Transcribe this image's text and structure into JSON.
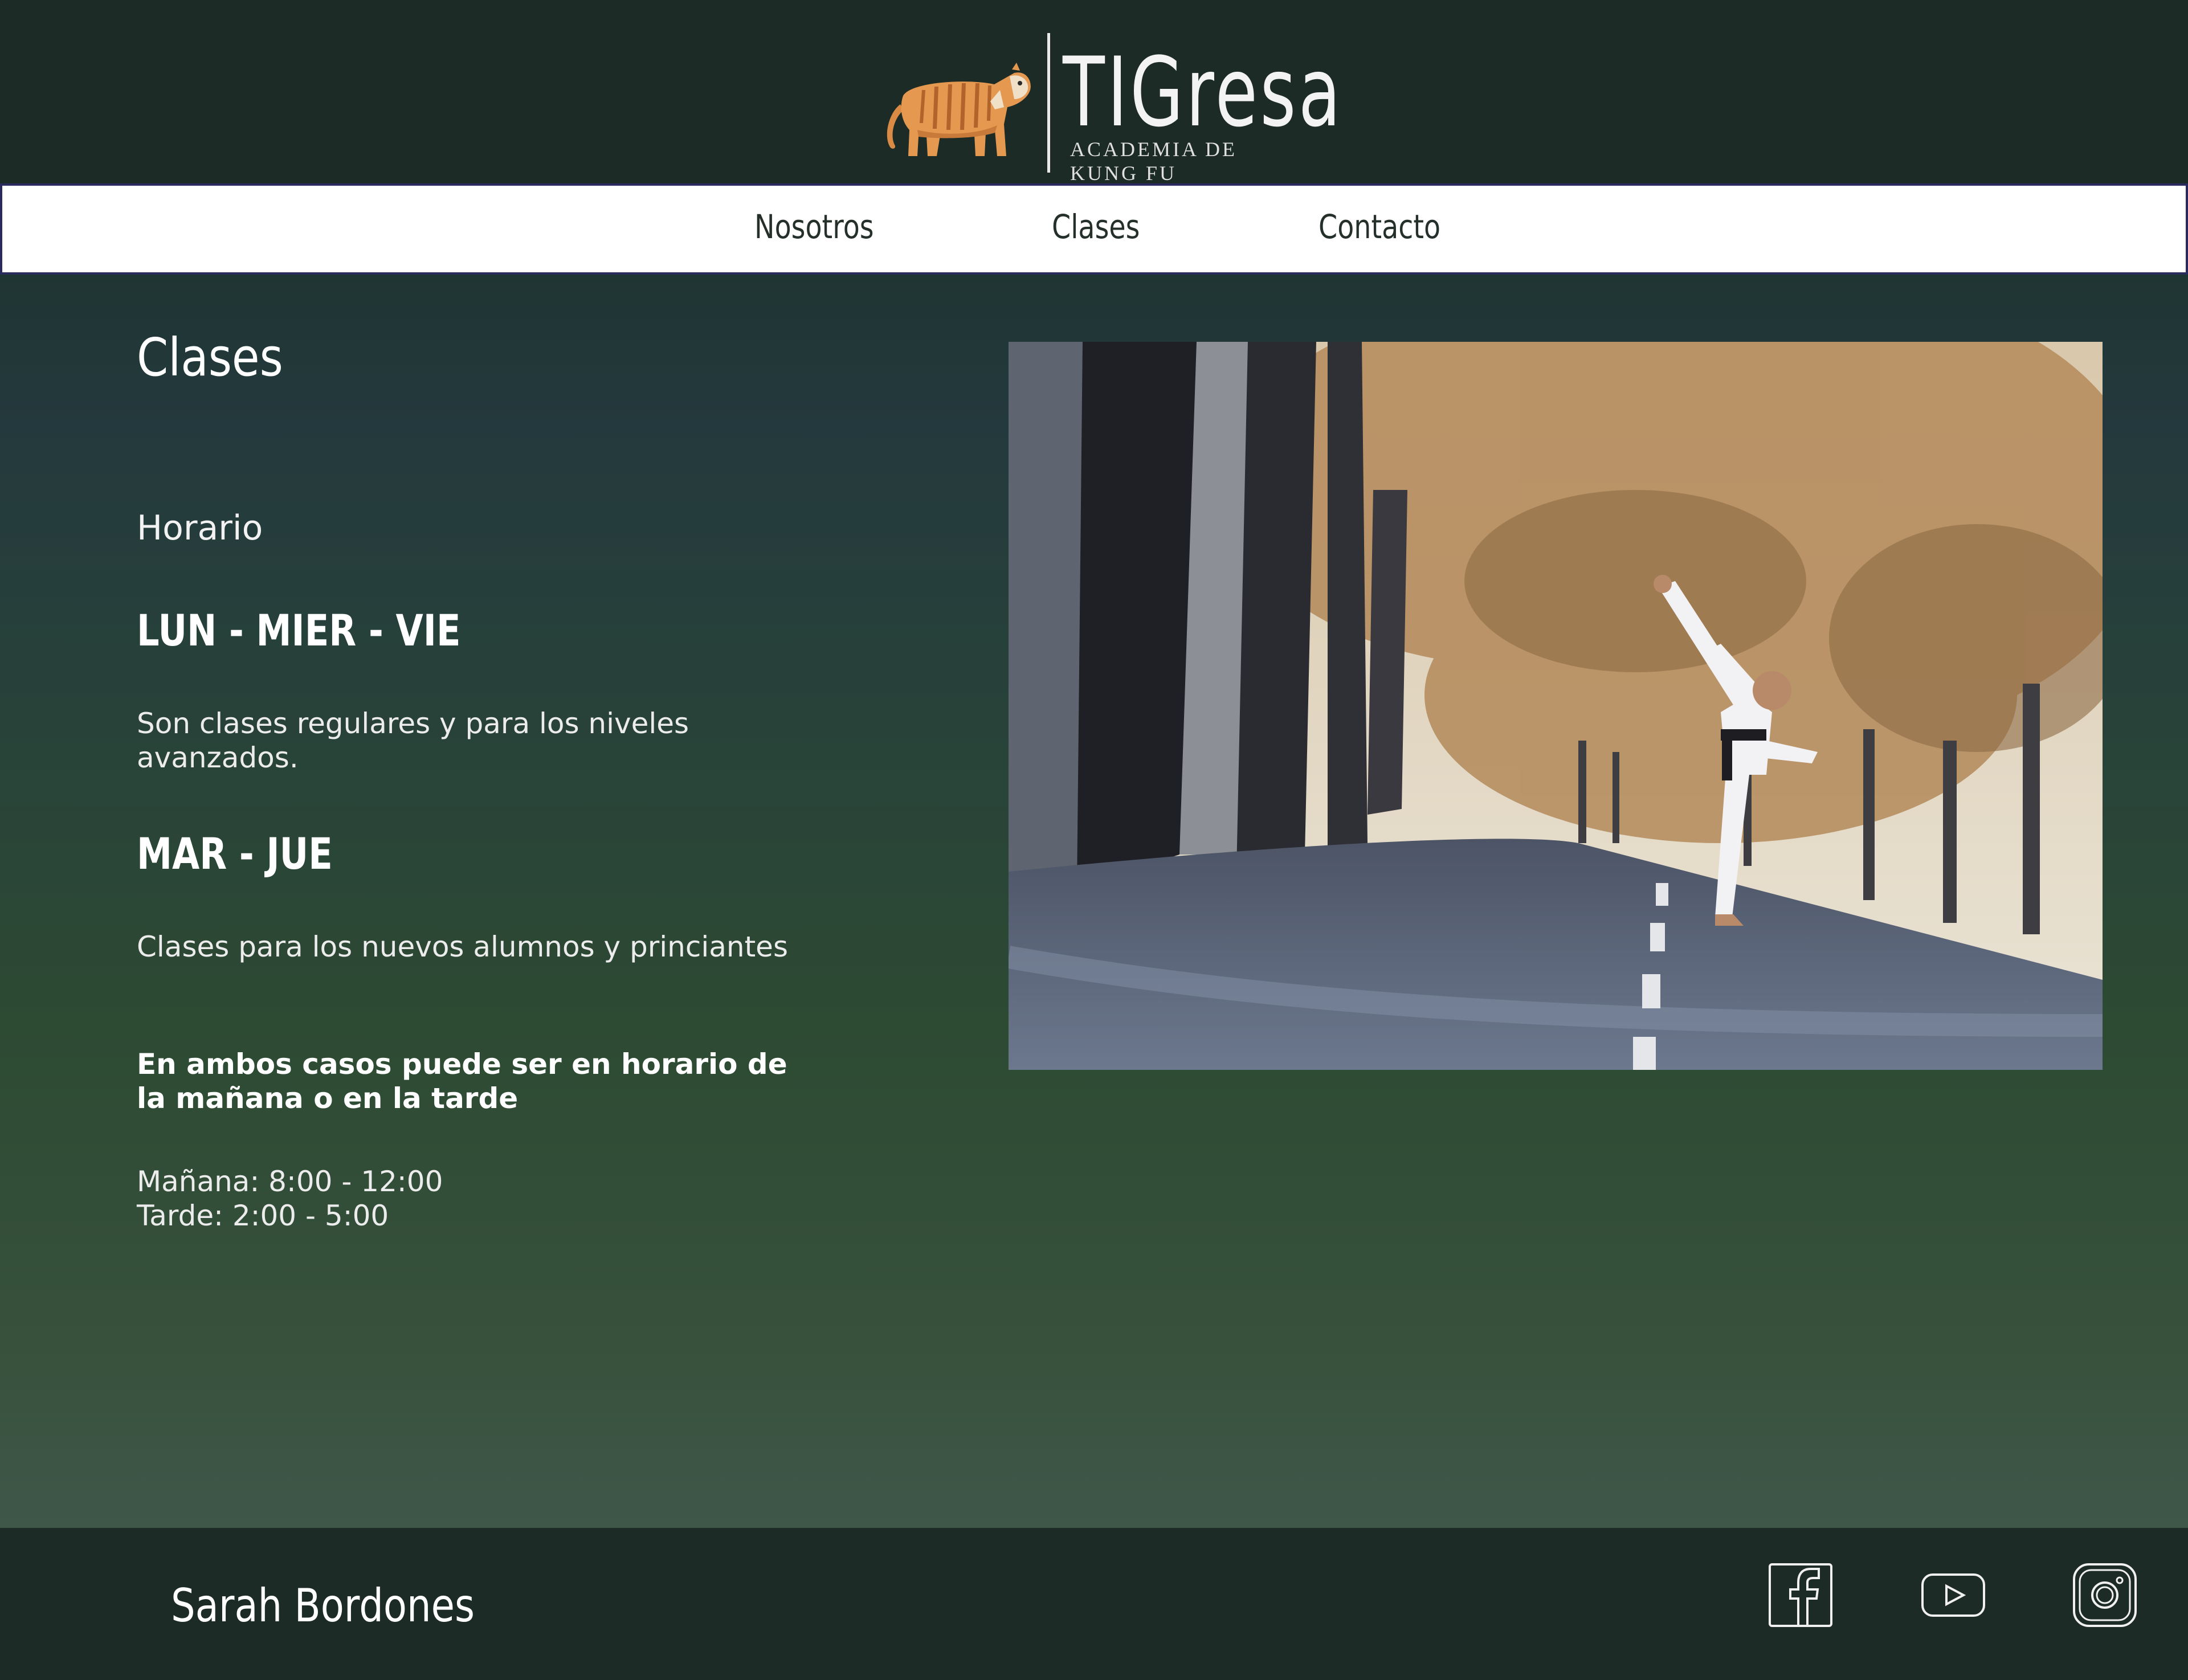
{
  "brand": {
    "name": "TIGresa",
    "tagline": "ACADEMIA DE KUNG FU"
  },
  "nav": {
    "items": [
      "Nosotros",
      "Clases",
      "Contacto"
    ]
  },
  "main": {
    "title": "Clases",
    "schedule_heading": "Horario",
    "groups": [
      {
        "days": "LUN - MIER - VIE",
        "description": "Son clases regulares y para los niveles avanzados."
      },
      {
        "days": "MAR - JUE",
        "description": "Clases para los nuevos alumnos y princiantes"
      }
    ],
    "note": "En ambos casos puede ser en horario de la mañana o en la tarde",
    "hours": {
      "morning": "Mañana: 8:00 - 12:00",
      "afternoon": "Tarde: 2:00 - 5:00"
    }
  },
  "footer": {
    "author": "Sarah Bordones",
    "social_icons": [
      "facebook-icon",
      "youtube-icon",
      "instagram-icon"
    ]
  },
  "colors": {
    "header_bg": "#1c2b25",
    "nav_border": "#2b2a5e",
    "tiger_orange": "#e0914a"
  }
}
